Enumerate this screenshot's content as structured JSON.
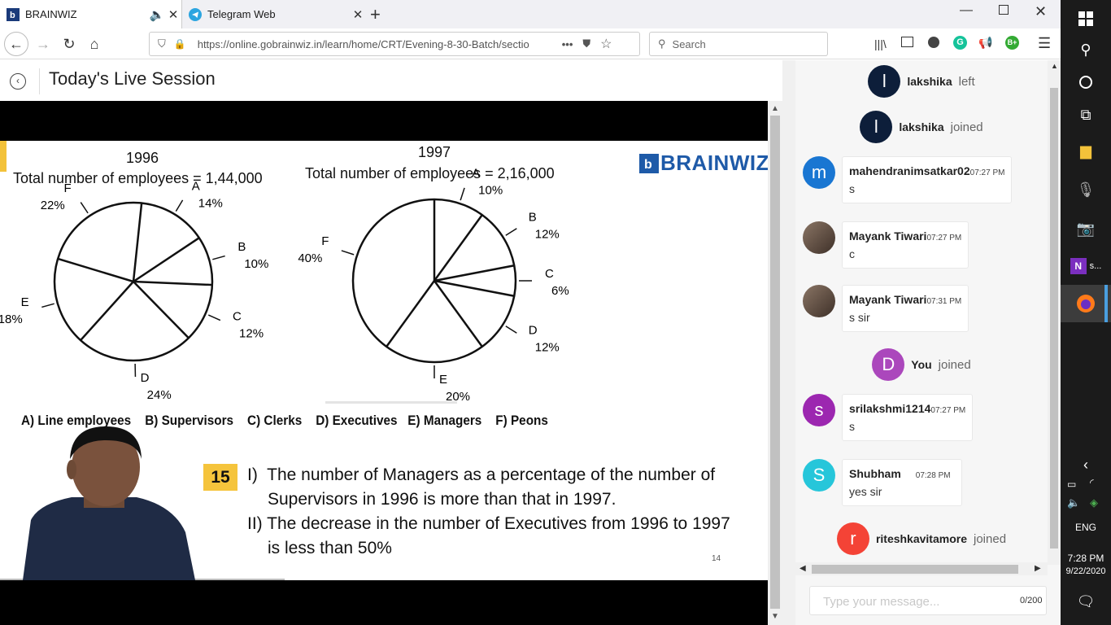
{
  "browser": {
    "tabs": [
      {
        "label": "BRAINWIZ"
      },
      {
        "label": "Telegram Web"
      }
    ],
    "url": "https://online.gobrainwiz.in/learn/home/CRT/Evening-8-30-Batch/sectio",
    "search_placeholder": "Search"
  },
  "page": {
    "title": "Today's Live Session"
  },
  "slide": {
    "logo": "BRAINWIZ",
    "chart1": {
      "year": "1996",
      "subtitle": "Total number of employees = 1,44,000"
    },
    "chart2": {
      "year": "1997",
      "subtitle": "Total number of employees = 2,16,000"
    },
    "legend": "A) Line employees    B) Supervisors    C) Clerks    D) Executives   E) Managers    F) Peons",
    "question_number": "15",
    "statement1_a": "I)  The number of Managers as a percentage of the number of",
    "statement1_b": "Supervisors in 1996 is more than that in 1997.",
    "statement2_a": "II) The decrease in the number of Executives from 1996 to 1997",
    "statement2_b": "is less than 50%",
    "page_no": "14"
  },
  "chart_data": [
    {
      "type": "pie",
      "title": "1996",
      "subtitle": "Total number of employees = 1,44,000",
      "categories": [
        "A",
        "B",
        "C",
        "D",
        "E",
        "F"
      ],
      "values": [
        14,
        10,
        12,
        24,
        18,
        22
      ],
      "value_labels": [
        "14%",
        "10%",
        "12%",
        "24%",
        "18%",
        "22%"
      ]
    },
    {
      "type": "pie",
      "title": "1997",
      "subtitle": "Total number of employees = 2,16,000",
      "categories": [
        "A",
        "B",
        "C",
        "D",
        "E",
        "F"
      ],
      "values": [
        10,
        12,
        6,
        12,
        20,
        40
      ],
      "value_labels": [
        "10%",
        "12%",
        "6%",
        "12%",
        "20%",
        "40%"
      ]
    }
  ],
  "chat": {
    "entries": [
      {
        "kind": "system",
        "avatar": "l",
        "color": "#0d1e3a",
        "name": "lakshika",
        "action": "left"
      },
      {
        "kind": "system",
        "avatar": "l",
        "color": "#0d1e3a",
        "name": "lakshika",
        "action": "joined"
      },
      {
        "kind": "message",
        "avatar": "m",
        "color": "#1976d2",
        "name": "mahendranimsatkar02",
        "time": "07:27 PM",
        "text": "s"
      },
      {
        "kind": "message",
        "avatar": "photo",
        "color": "#6b5a4a",
        "name": "Mayank Tiwari",
        "time": "07:27 PM",
        "text": "c"
      },
      {
        "kind": "message",
        "avatar": "photo",
        "color": "#6b5a4a",
        "name": "Mayank Tiwari",
        "time": "07:31 PM",
        "text": "s sir"
      },
      {
        "kind": "system",
        "avatar": "D",
        "color": "#ab47bc",
        "name": "You",
        "action": "joined"
      },
      {
        "kind": "message",
        "avatar": "s",
        "color": "#9c27b0",
        "name": "srilakshmi1214",
        "time": "07:27 PM",
        "text": "s"
      },
      {
        "kind": "message",
        "avatar": "S",
        "color": "#26c6da",
        "name": "Shubham",
        "time": "07:28 PM",
        "text": "yes sir"
      },
      {
        "kind": "system",
        "avatar": "r",
        "color": "#f44336",
        "name": "riteshkavitamore",
        "action": "joined"
      }
    ],
    "input_placeholder": "Type your message...",
    "char_count": "0/200"
  },
  "taskbar": {
    "app_label": "s...",
    "language": "ENG",
    "time": "7:28 PM",
    "date": "9/22/2020"
  }
}
